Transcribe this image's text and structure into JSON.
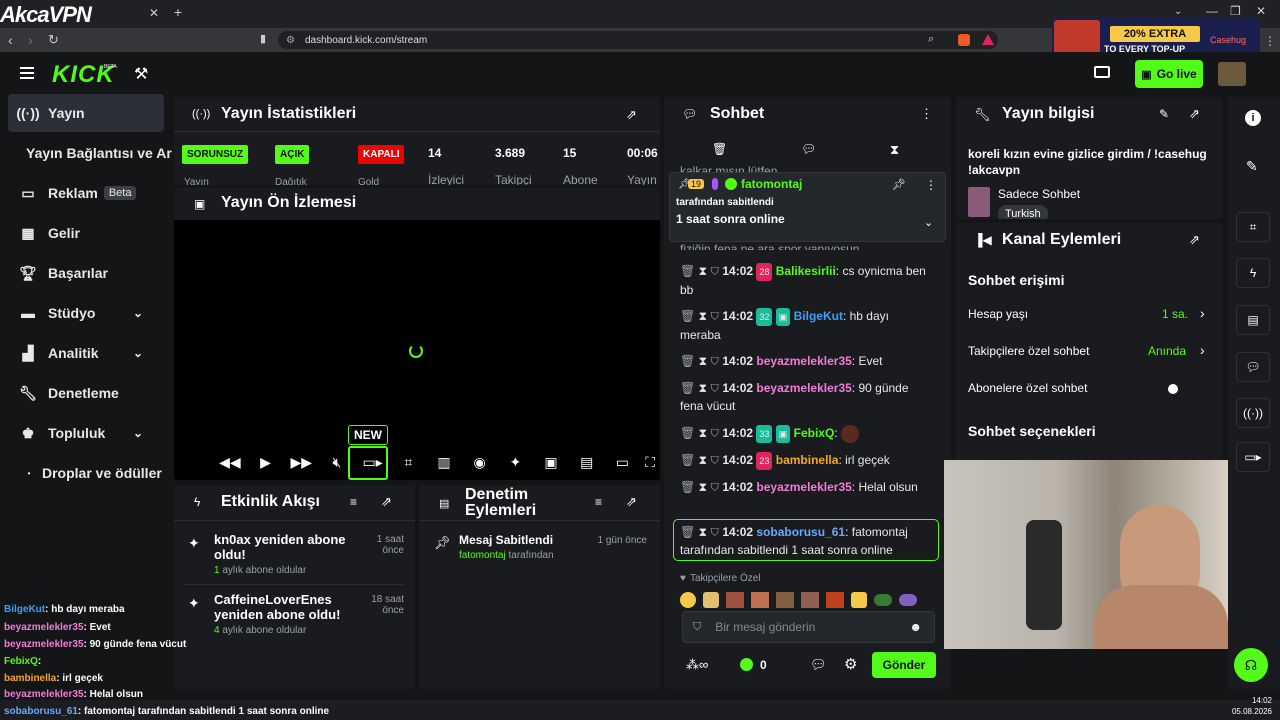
{
  "browser": {
    "watermark": "AkcaVPN",
    "url": "dashboard.kick.com/stream",
    "ad_line1": "20% EXTRA",
    "ad_line2": "TO EVERY TOP-UP",
    "ad_brand": "Casehug"
  },
  "header": {
    "logo": "KICK",
    "logo_beta": "BETA",
    "go_live": "Go live"
  },
  "sidebar": {
    "items": [
      {
        "label": "Yayın",
        "icon": "broadcast-icon"
      },
      {
        "label": "Yayın Bağlantısı ve Ar",
        "icon": ""
      },
      {
        "label": "Reklam",
        "badge": "Beta",
        "icon": "ad-icon"
      },
      {
        "label": "Gelir",
        "icon": "revenue-icon"
      },
      {
        "label": "Başarılar",
        "icon": "trophy-icon"
      },
      {
        "label": "Stüdyo",
        "icon": "studio-icon"
      },
      {
        "label": "Analitik",
        "icon": "analytics-icon"
      },
      {
        "label": "Denetleme",
        "icon": "wrench-icon"
      },
      {
        "label": "Topluluk",
        "icon": "community-icon"
      },
      {
        "label": "Droplar ve ödüller",
        "icon": "dot-icon"
      }
    ]
  },
  "stats": {
    "title": "Yayın İstatistikleri",
    "items": [
      {
        "value": "SORUNSUZ",
        "label": "Yayın",
        "color": "#53fc18"
      },
      {
        "value": "AÇIK",
        "label": "Dağıtık",
        "color": "#53fc18"
      },
      {
        "value": "KAPALI",
        "label": "Gold",
        "color": "#eb0400"
      },
      {
        "value": "14",
        "label": "İzleyici"
      },
      {
        "value": "3.689",
        "label": "Takipçi"
      },
      {
        "value": "15",
        "label": "Abone"
      },
      {
        "value": "00:06",
        "label": "Yayın"
      }
    ]
  },
  "preview": {
    "title": "Yayın Ön İzlemesi",
    "new_badge": "NEW"
  },
  "activity": {
    "title": "Etkinlik Akışı",
    "items": [
      {
        "title": "kn0ax yeniden abone oldu!",
        "count": "1",
        "sub": "aylık abone oldular",
        "time": "1 saat önce"
      },
      {
        "title": "CaffeineLoverEnes yeniden abone oldu!",
        "count": "4",
        "sub": "aylık abone oldular",
        "time": "18 saat önce"
      }
    ]
  },
  "moderation": {
    "title": "Denetim Eylemleri",
    "items": [
      {
        "title": "Mesaj Sabitlendi",
        "user": "fatomontaj",
        "suffix": "tarafından",
        "time": "1 gün önce"
      }
    ]
  },
  "chat": {
    "title": "Sohbet",
    "pinned": {
      "badge": "19",
      "user": "fatomontaj",
      "by": "tarafından sabitlendi",
      "text": "1 saat sonra online"
    },
    "partial_top": "kalkar mısın lütfen",
    "partial_mid": "fiziğin fena ne ara spor yapıyosun",
    "messages": [
      {
        "time": "14:02",
        "badge": "28",
        "user": "Balikesirlii",
        "color": "#53fc18",
        "text": "cs oynicma ben bb"
      },
      {
        "time": "14:02",
        "badge": "32",
        "user": "BilgeKut",
        "color": "#3a9ff8",
        "text": "hb dayı meraba"
      },
      {
        "time": "14:02",
        "badge": "",
        "user": "beyazmelekler35",
        "color": "#f07cd8",
        "text": "Evet"
      },
      {
        "time": "14:02",
        "badge": "",
        "user": "beyazmelekler35",
        "color": "#f07cd8",
        "text": "90 günde fena vücut"
      },
      {
        "time": "14:02",
        "badge": "33",
        "user": "FebixQ",
        "color": "#53fc18",
        "text": ""
      },
      {
        "time": "14:02",
        "badge": "23",
        "user": "bambinella",
        "color": "#f5a623",
        "text": "irl geçek"
      },
      {
        "time": "14:02",
        "badge": "",
        "user": "beyazmelekler35",
        "color": "#f07cd8",
        "text": "Helal olsun"
      },
      {
        "time": "14:02",
        "badge": "",
        "user": "sobaborusu_61",
        "color": "#6aa9ff",
        "text": "fatomontaj tarafından sabitlendi 1 saat sonra online"
      }
    ],
    "followers_only": "Takipçilere Özel",
    "input_placeholder": "Bir mesaj gönderin",
    "points": "0",
    "send": "Gönder"
  },
  "info": {
    "title": "Yayın bilgisi",
    "stream_title": "koreli kızın evine gizlice girdim / !casehug !akcavpn",
    "category": "Sadece Sohbet",
    "language": "Turkish"
  },
  "channel": {
    "title": "Kanal Eylemleri",
    "chat_access": "Sohbet erişimi",
    "rows": [
      {
        "label": "Hesap yaşı",
        "value": "1 sa."
      },
      {
        "label": "Takipçilere özel sohbet",
        "value": "Anında"
      },
      {
        "label": "Abonelere özel sohbet",
        "value": ""
      }
    ],
    "chat_options": "Sohbet seçenekleri"
  },
  "overlay_chat": [
    {
      "user": "BilgeKut",
      "color": "#3a9ff8",
      "text": ": hb dayı meraba"
    },
    {
      "user": "beyazmelekler35",
      "color": "#f07cd8",
      "text": ": Evet"
    },
    {
      "user": "beyazmelekler35",
      "color": "#f07cd8",
      "text": ": 90 günde fena vücut"
    },
    {
      "user": "FebixQ",
      "color": "#53fc18",
      "text": ":"
    },
    {
      "user": "bambinella",
      "color": "#f5a623",
      "text": ": irl geçek"
    },
    {
      "user": "beyazmelekler35",
      "color": "#f07cd8",
      "text": ": Helal olsun"
    },
    {
      "user": "sobaborusu_61",
      "color": "#6aa9ff",
      "text": ": fatomontaj tarafından sabitlendi 1 saat sonra online"
    }
  ],
  "taskbar": {
    "time": "14:02",
    "date": "05.08.2026"
  }
}
